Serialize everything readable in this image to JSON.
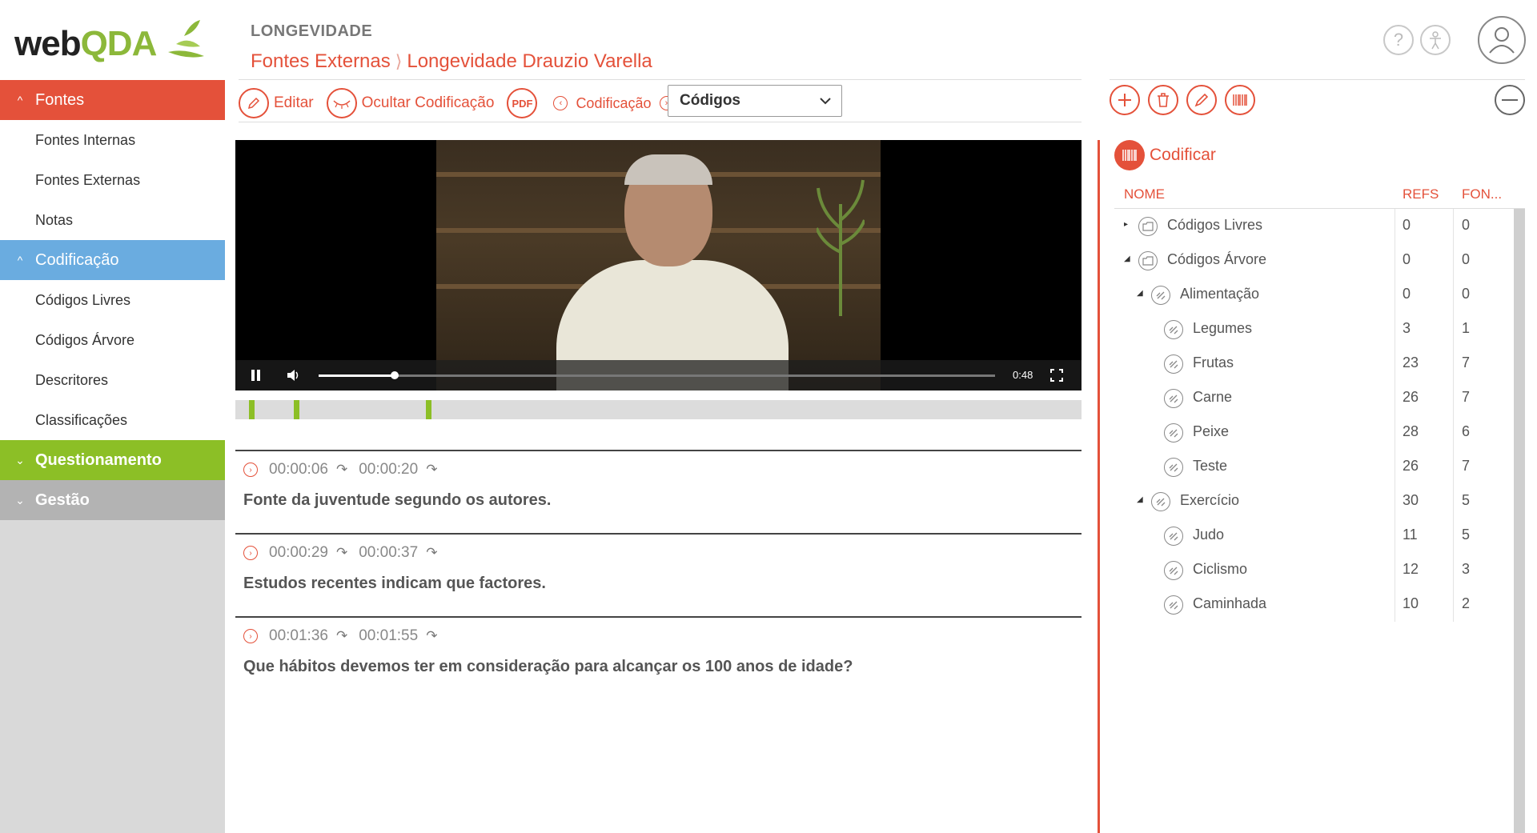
{
  "logo": {
    "text_main": "web",
    "text_accent": "QDA"
  },
  "sidebar": {
    "sections": [
      {
        "label": "Fontes",
        "color": "#e4513a",
        "expanded": true,
        "items": [
          "Fontes Internas",
          "Fontes Externas",
          "Notas"
        ]
      },
      {
        "label": "Codificação",
        "color": "#6aace0",
        "expanded": true,
        "items": [
          "Códigos Livres",
          "Códigos Árvore",
          "Descritores",
          "Classificações"
        ]
      },
      {
        "label": "Questionamento",
        "color": "#8cbf26",
        "expanded": false,
        "items": []
      },
      {
        "label": "Gestão",
        "color": "#b3b3b3",
        "expanded": false,
        "items": []
      }
    ]
  },
  "header": {
    "project": "LONGEVIDADE",
    "breadcrumb": [
      "Fontes Externas",
      "Longevidade Drauzio Varella"
    ]
  },
  "top_icons": [
    "help-icon",
    "accessibility-icon",
    "user-avatar-icon"
  ],
  "toolbar": {
    "edit_label": "Editar",
    "hide_coding_label": "Ocultar Codificação",
    "pdf_label": "PDF",
    "coding_nav_label": "Codificação",
    "select_value": "Códigos"
  },
  "video": {
    "time": "0:48",
    "progress": 0.113,
    "timeline_marks": [
      0.016,
      0.069,
      0.225
    ]
  },
  "segments": [
    {
      "start": "00:00:06",
      "end": "00:00:20",
      "text": "Fonte da juventude segundo os autores."
    },
    {
      "start": "00:00:29",
      "end": "00:00:37",
      "text": "Estudos recentes indicam que factores."
    },
    {
      "start": "00:01:36",
      "end": "00:01:55",
      "text": "Que hábitos devemos ter em consideração para alcançar os 100 anos de idade?"
    }
  ],
  "right_panel": {
    "toolbar_icons": [
      "add-icon",
      "trash-icon",
      "edit-code-icon",
      "barcode-icon",
      "collapse-icon"
    ],
    "title": "Codificar",
    "columns": {
      "name": "NOME",
      "refs": "REFS",
      "fontes": "FON..."
    },
    "rows": [
      {
        "name": "Códigos Livres",
        "refs": "0",
        "fontes": "0",
        "level": 0,
        "toggle": "collapsed",
        "type": "folder"
      },
      {
        "name": "Códigos Árvore",
        "refs": "0",
        "fontes": "0",
        "level": 0,
        "toggle": "expanded",
        "type": "folder"
      },
      {
        "name": "Alimentação",
        "refs": "0",
        "fontes": "0",
        "level": 1,
        "toggle": "expanded",
        "type": "code"
      },
      {
        "name": "Legumes",
        "refs": "3",
        "fontes": "1",
        "level": 2,
        "toggle": "none",
        "type": "code"
      },
      {
        "name": "Frutas",
        "refs": "23",
        "fontes": "7",
        "level": 2,
        "toggle": "none",
        "type": "code"
      },
      {
        "name": "Carne",
        "refs": "26",
        "fontes": "7",
        "level": 2,
        "toggle": "none",
        "type": "code"
      },
      {
        "name": "Peixe",
        "refs": "28",
        "fontes": "6",
        "level": 2,
        "toggle": "none",
        "type": "code"
      },
      {
        "name": "Teste",
        "refs": "26",
        "fontes": "7",
        "level": 2,
        "toggle": "none",
        "type": "code"
      },
      {
        "name": "Exercício",
        "refs": "30",
        "fontes": "5",
        "level": 1,
        "toggle": "expanded",
        "type": "code"
      },
      {
        "name": "Judo",
        "refs": "11",
        "fontes": "5",
        "level": 2,
        "toggle": "none",
        "type": "code"
      },
      {
        "name": "Ciclismo",
        "refs": "12",
        "fontes": "3",
        "level": 2,
        "toggle": "none",
        "type": "code"
      },
      {
        "name": "Caminhada",
        "refs": "10",
        "fontes": "2",
        "level": 2,
        "toggle": "none",
        "type": "code"
      }
    ]
  },
  "colors": {
    "accent": "#e4513a",
    "green": "#8cbf26",
    "blue": "#6aace0",
    "grey": "#b3b3b3"
  }
}
